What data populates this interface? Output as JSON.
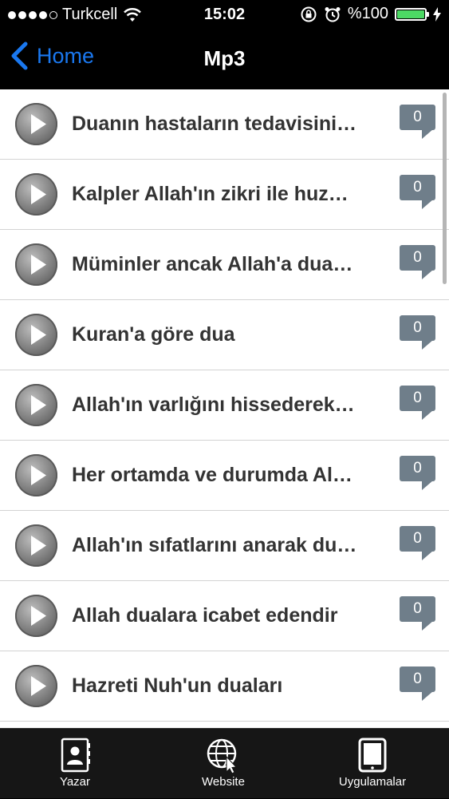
{
  "status": {
    "carrier": "Turkcell",
    "time": "15:02",
    "battery": "%100",
    "signal_icon": "signal-dots-icon",
    "wifi_icon": "wifi-icon",
    "lock_icon": "rotation-lock-icon",
    "alarm_icon": "alarm-icon",
    "charging_icon": "charging-bolt-icon",
    "battery_color": "#4cd964"
  },
  "nav": {
    "back_label": "Home",
    "title": "Mp3",
    "accent": "#1a78f0"
  },
  "items": [
    {
      "title": "Duanın hastaların tedavisini…",
      "count": "0"
    },
    {
      "title": "Kalpler Allah'ın zikri ile huz…",
      "count": "0"
    },
    {
      "title": "Müminler ancak Allah'a dua…",
      "count": "0"
    },
    {
      "title": "Kuran'a göre dua",
      "count": "0"
    },
    {
      "title": "Allah'ın varlığını hissederek…",
      "count": "0"
    },
    {
      "title": "Her ortamda ve durumda Al…",
      "count": "0"
    },
    {
      "title": "Allah'ın sıfatlarını anarak du…",
      "count": "0"
    },
    {
      "title": "Allah dualara icabet edendir",
      "count": "0"
    },
    {
      "title": "Hazreti Nuh'un duaları",
      "count": "0"
    }
  ],
  "tabs": {
    "author": "Yazar",
    "website": "Website",
    "apps": "Uygulamalar"
  }
}
